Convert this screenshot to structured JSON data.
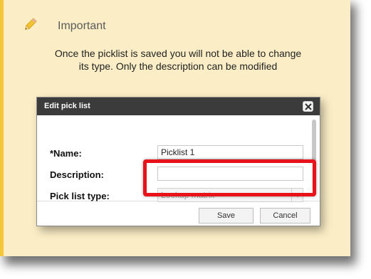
{
  "callout": {
    "title": "Important",
    "message": "Once the picklist is saved you will not be able to change its type. Only the description can be modified",
    "icon": "pencil-icon",
    "colors": {
      "background": "#fbeec6",
      "accent": "#f5c63a"
    }
  },
  "dialog": {
    "title": "Edit pick list",
    "close_icon": "close-icon",
    "fields": {
      "name_label": "*Name:",
      "name_value": "Picklist 1",
      "description_label": "Description:",
      "description_value": "",
      "type_label": "Pick list type:",
      "type_value": "Lookup matrix"
    },
    "buttons": {
      "save_label": "Save",
      "cancel_label": "Cancel"
    },
    "highlight_color": "#e8121a"
  }
}
